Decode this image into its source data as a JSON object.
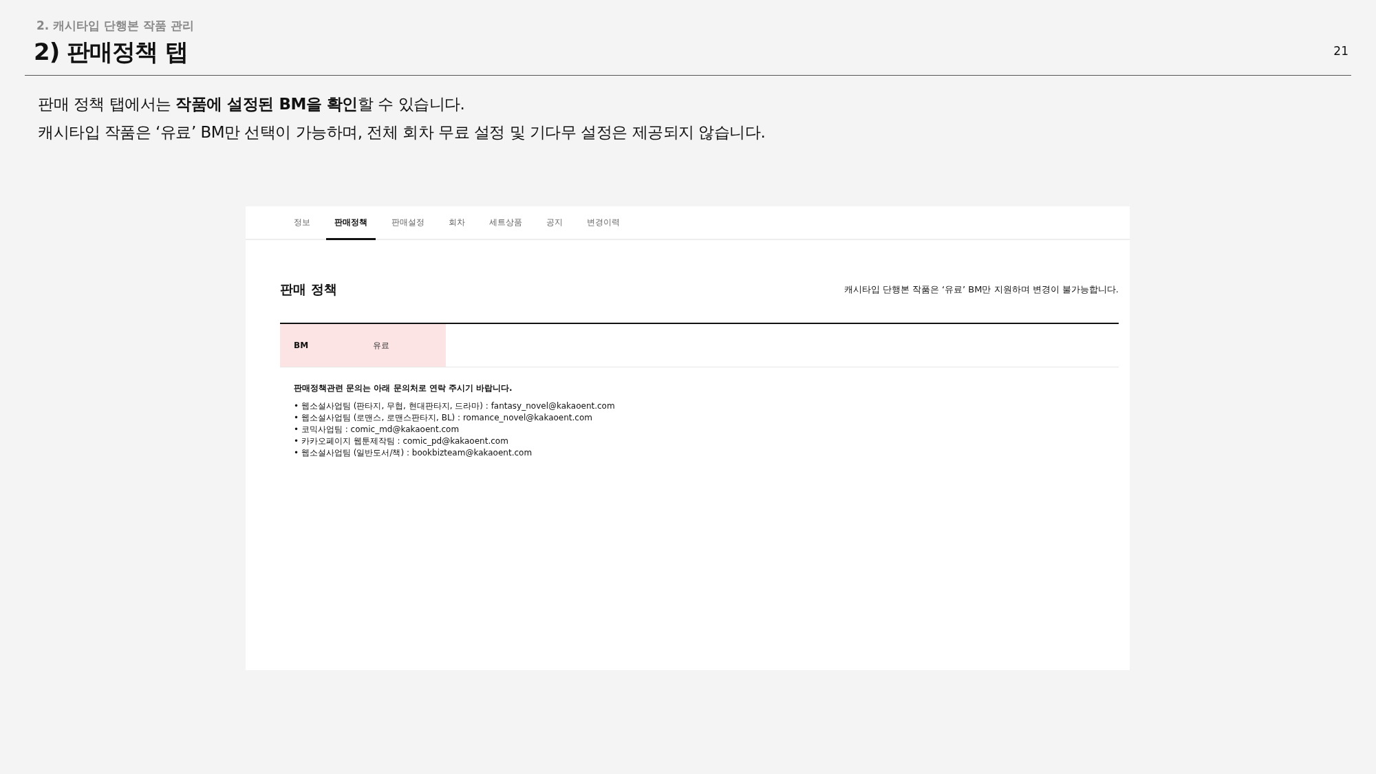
{
  "section_label": "2. 캐시타입 단행본 작품 관리",
  "title": "2) 판매정책 탭",
  "page_number": "21",
  "description": [
    "판매 정책 탭에서는 **작품에 설정된 BM을 확인**할 수 있습니다.",
    "캐시타입 작품은 ‘유료’ BM만 선택이 가능하며, 전체 회차 무료 설정 및 기다무 설정은 제공되지 않습니다."
  ],
  "screen": {
    "tabs": [
      {
        "label": "정보",
        "selected": false
      },
      {
        "label": "판매정책",
        "selected": true
      },
      {
        "label": "판매설정",
        "selected": false
      },
      {
        "label": "회차",
        "selected": false
      },
      {
        "label": "세트상품",
        "selected": false
      },
      {
        "label": "공지",
        "selected": false
      },
      {
        "label": "변경이력",
        "selected": false
      }
    ],
    "heading": "판매 정책",
    "note": "캐시타입 단행본 작품은 ‘유료’ BM만 지원하며 변경이 불가능합니다.",
    "bm_row": {
      "label": "BM",
      "value": "유료"
    },
    "contact_title": "판매정책관련 문의는 아래 문의처로 연락 주시기 바랍니다.",
    "contacts": [
      "• 웹소설사업팀 (판타지, 무협, 현대판타지, 드라마) : fantasy_novel@kakaoent.com",
      "• 웹소설사업팀 (로맨스, 로맨스판타지, BL) : romance_novel@kakaoent.com",
      "• 코믹사업팀 : comic_md@kakaoent.com",
      "• 카카오페이지 웹툰제작팀 : comic_pd@kakaoent.com",
      "• 웹소설사업팀 (일반도서/책) : bookbizteam@kakaoent.com"
    ]
  }
}
